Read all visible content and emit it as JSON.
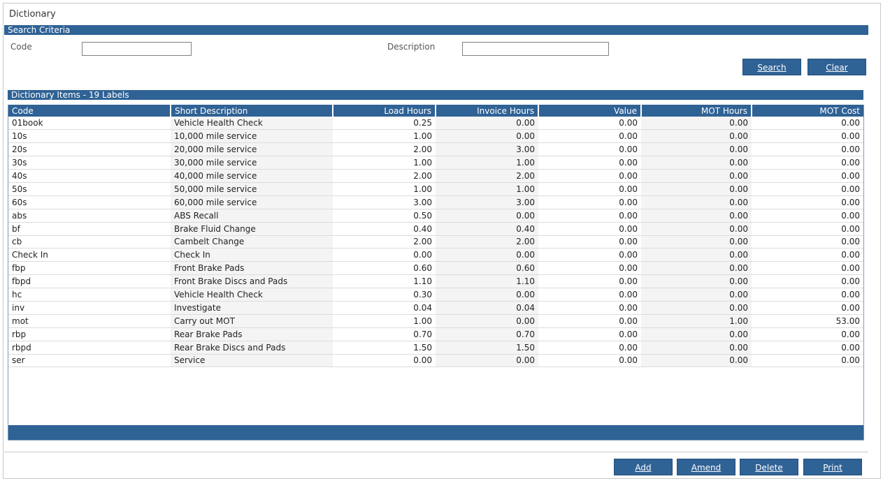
{
  "window": {
    "title": "Dictionary"
  },
  "search": {
    "band_title": "Search Criteria",
    "code_label": "Code",
    "code_value": "",
    "description_label": "Description",
    "description_value": "",
    "search_button": "Search",
    "clear_button": "Clear"
  },
  "grid": {
    "band_title": "Dictionary Items - 19 Labels",
    "columns": [
      "Code",
      "Short Description",
      "Load Hours",
      "Invoice Hours",
      "Value",
      "MOT Hours",
      "MOT Cost"
    ],
    "rows": [
      [
        "01book",
        "Vehicle Health Check",
        "0.25",
        "0.00",
        "0.00",
        "0.00",
        "0.00"
      ],
      [
        "10s",
        "10,000 mile service",
        "1.00",
        "0.00",
        "0.00",
        "0.00",
        "0.00"
      ],
      [
        "20s",
        "20,000 mile service",
        "2.00",
        "3.00",
        "0.00",
        "0.00",
        "0.00"
      ],
      [
        "30s",
        "30,000 mile service",
        "1.00",
        "1.00",
        "0.00",
        "0.00",
        "0.00"
      ],
      [
        "40s",
        "40,000 mile service",
        "2.00",
        "2.00",
        "0.00",
        "0.00",
        "0.00"
      ],
      [
        "50s",
        "50,000 mile service",
        "1.00",
        "1.00",
        "0.00",
        "0.00",
        "0.00"
      ],
      [
        "60s",
        "60,000 mile service",
        "3.00",
        "3.00",
        "0.00",
        "0.00",
        "0.00"
      ],
      [
        "abs",
        "ABS Recall",
        "0.50",
        "0.00",
        "0.00",
        "0.00",
        "0.00"
      ],
      [
        "bf",
        "Brake Fluid Change",
        "0.40",
        "0.40",
        "0.00",
        "0.00",
        "0.00"
      ],
      [
        "cb",
        "Cambelt Change",
        "2.00",
        "2.00",
        "0.00",
        "0.00",
        "0.00"
      ],
      [
        "Check In",
        "Check In",
        "0.00",
        "0.00",
        "0.00",
        "0.00",
        "0.00"
      ],
      [
        "fbp",
        "Front Brake Pads",
        "0.60",
        "0.60",
        "0.00",
        "0.00",
        "0.00"
      ],
      [
        "fbpd",
        "Front Brake Discs and Pads",
        "1.10",
        "1.10",
        "0.00",
        "0.00",
        "0.00"
      ],
      [
        "hc",
        "Vehicle Health Check",
        "0.30",
        "0.00",
        "0.00",
        "0.00",
        "0.00"
      ],
      [
        "inv",
        "Investigate",
        "0.04",
        "0.04",
        "0.00",
        "0.00",
        "0.00"
      ],
      [
        "mot",
        "Carry out MOT",
        "1.00",
        "0.00",
        "0.00",
        "1.00",
        "53.00"
      ],
      [
        "rbp",
        "Rear Brake Pads",
        "0.70",
        "0.70",
        "0.00",
        "0.00",
        "0.00"
      ],
      [
        "rbpd",
        "Rear Brake Discs and Pads",
        "1.50",
        "1.50",
        "0.00",
        "0.00",
        "0.00"
      ],
      [
        "ser",
        "Service",
        "0.00",
        "0.00",
        "0.00",
        "0.00",
        "0.00"
      ]
    ]
  },
  "actions": {
    "add": "Add",
    "amend": "Amend",
    "delete": "Delete",
    "print": "Print"
  },
  "colors": {
    "accent": "#2f6295",
    "shaded_cell": "#f4f4f4"
  }
}
